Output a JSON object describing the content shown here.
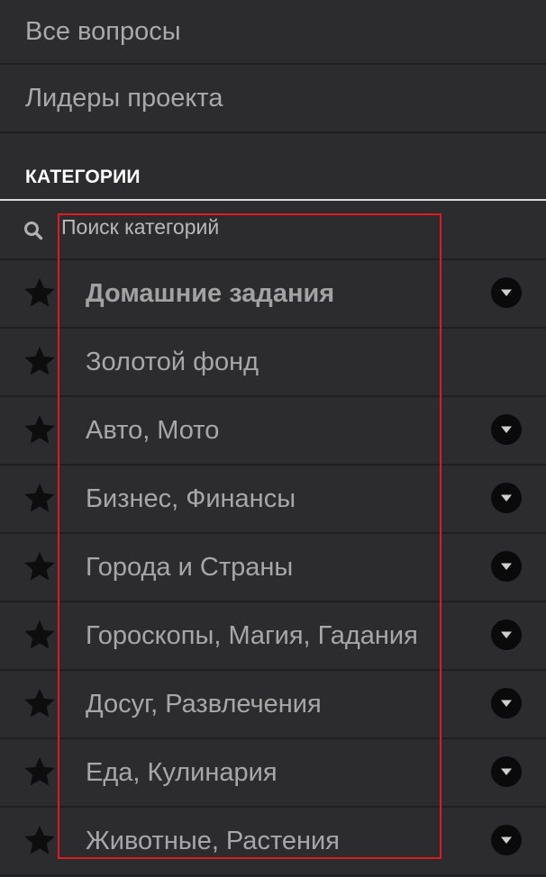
{
  "nav": {
    "all_questions": "Все вопросы",
    "project_leaders": "Лидеры проекта"
  },
  "categories_header": "КАТЕГОРИИ",
  "search": {
    "placeholder": "Поиск категорий",
    "value": ""
  },
  "categories": [
    {
      "label": "Домашние задания",
      "bold": true,
      "has_dropdown": true
    },
    {
      "label": "Золотой фонд",
      "bold": false,
      "has_dropdown": false
    },
    {
      "label": "Авто, Мото",
      "bold": false,
      "has_dropdown": true
    },
    {
      "label": "Бизнес, Финансы",
      "bold": false,
      "has_dropdown": true
    },
    {
      "label": "Города и Страны",
      "bold": false,
      "has_dropdown": true
    },
    {
      "label": "Гороскопы, Магия, Гадания",
      "bold": false,
      "has_dropdown": true
    },
    {
      "label": "Досуг, Развлечения",
      "bold": false,
      "has_dropdown": true
    },
    {
      "label": "Еда, Кулинария",
      "bold": false,
      "has_dropdown": true
    },
    {
      "label": "Животные, Растения",
      "bold": false,
      "has_dropdown": true
    }
  ],
  "icons": {
    "search": "search-icon",
    "favorite": "star-icon",
    "expand": "chevron-down-icon"
  },
  "colors": {
    "background": "#2c2c2e",
    "divider": "#1f1f21",
    "header_text": "#ffffff",
    "item_text": "#a8a8a8",
    "highlight_border": "#e01a22"
  }
}
